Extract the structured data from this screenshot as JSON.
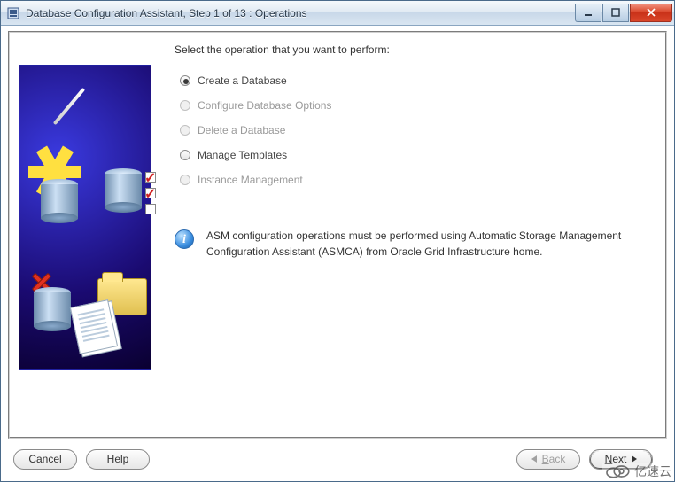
{
  "window": {
    "title": "Database Configuration Assistant, Step 1 of 13 : Operations"
  },
  "prompt": "Select the operation that you want to perform:",
  "options": [
    {
      "label": "Create a Database",
      "selected": true,
      "enabled": true
    },
    {
      "label": "Configure Database Options",
      "selected": false,
      "enabled": false
    },
    {
      "label": "Delete a Database",
      "selected": false,
      "enabled": false
    },
    {
      "label": "Manage Templates",
      "selected": false,
      "enabled": true
    },
    {
      "label": "Instance Management",
      "selected": false,
      "enabled": false
    }
  ],
  "info_message": "ASM configuration operations must be performed using Automatic Storage Management Configuration Assistant (ASMCA) from Oracle Grid Infrastructure home.",
  "buttons": {
    "cancel": "Cancel",
    "help": "Help",
    "back": "Back",
    "next": "Next"
  },
  "watermark": "亿速云"
}
